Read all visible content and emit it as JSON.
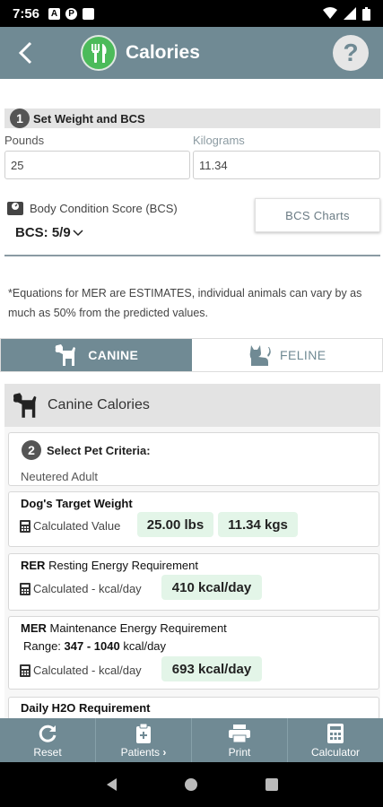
{
  "status_bar": {
    "time": "7:56",
    "left_icons": [
      "A",
      "P",
      "■"
    ]
  },
  "header": {
    "title": "Calories",
    "help_label": "?"
  },
  "weight_section": {
    "step_number": "1",
    "step_title": "Set Weight and BCS",
    "pounds_label": "Pounds",
    "pounds_value": "25",
    "kilograms_label": "Kilograms",
    "kilograms_value": "11.34",
    "bcs_label": "Body Condition Score (BCS)",
    "bcs_value": "BCS: 5/9",
    "bcs_charts_button": "BCS Charts"
  },
  "disclaimer": "*Equations for MER are ESTIMATES, individual animals can vary by as much as 50% from the predicted values.",
  "species_tabs": {
    "canine": "CANINE",
    "feline": "FELINE",
    "selected": "canine"
  },
  "calories_panel": {
    "title": "Canine Calories",
    "criteria": {
      "step_number": "2",
      "title": "Select Pet Criteria:",
      "value": "Neutered Adult"
    },
    "target_weight": {
      "title": "Dog's Target Weight",
      "sub_label": "Calculated Value",
      "lbs": "25.00 lbs",
      "kgs": "11.34 kgs"
    },
    "rer": {
      "abbr": "RER",
      "title": "Resting Energy Requirement",
      "sub_label": "Calculated - kcal/day",
      "value": "410 kcal/day"
    },
    "mer": {
      "abbr": "MER",
      "title": "Maintenance Energy Requirement",
      "range_label": "Range:",
      "range_value": "347 - 1040",
      "range_unit": "kcal/day",
      "sub_label": "Calculated - kcal/day",
      "value": "693 kcal/day"
    },
    "h2o": {
      "title": "Daily H2O Requirement"
    }
  },
  "bottom_nav": {
    "reset": "Reset",
    "patients": "Patients",
    "print": "Print",
    "calculator": "Calculator"
  },
  "colors": {
    "header": "#708a94",
    "accent_green": "#4cbb5a",
    "pill_bg": "#e3f5e8"
  }
}
